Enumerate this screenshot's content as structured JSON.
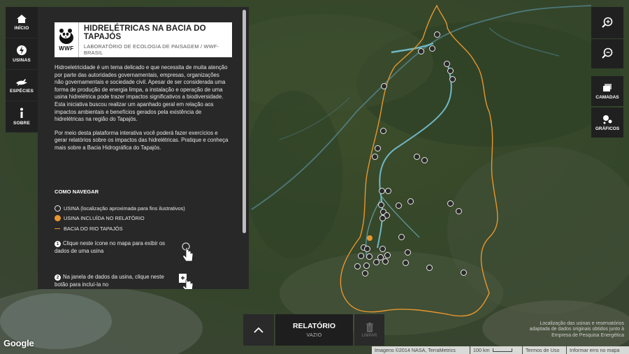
{
  "nav": {
    "items": [
      {
        "label": "INÍCIO",
        "icon": "home-icon"
      },
      {
        "label": "USINAS",
        "icon": "lightning-icon"
      },
      {
        "label": "ESPÉCIES",
        "icon": "bird-icon"
      },
      {
        "label": "SOBRE",
        "icon": "info-icon"
      }
    ]
  },
  "panel": {
    "logo_wwf": "WWF",
    "title": "HIDRELÉTRICAS NA BACIA DO TAPAJÓS",
    "subtitle": "LABORATÓRIO DE ECOLOGIA DE PAISAGEM / WWF-BRASIL",
    "intro_p1": "Hidroeletricidade é um tema delicado e que necessita de muita atenção por parte das autoridades governamentais, empresas, organizações não governamentais e sociedade civil. Apesar de ser considerada uma forma de produção de energia limpa, a instalação e operação de uma usina hidrelétrica pode trazer impactos significativos a biodiversidade. Esta iniciativa buscou realizar um apanhado geral em relação aos impactos ambientais e benefícios gerados pela existência de hidrelétricas na região do Tapajós.",
    "intro_p2": "Por meio desta plataforma interativa você poderá fazer exercícios e gerar relatórios sobre os impactos das hidrelétricas. Pratique e conheça mais sobre a Bacia Hidrográfica do Tapajós.",
    "how_title": "COMO NAVEGAR",
    "legend": {
      "usina": "USINA (localização aproximada para fins ilustrativos)",
      "included": "USINA INCLUÍDA NO RELATÓRIO",
      "basin": "BACIA DO RIO TAPAJÓS"
    },
    "step1_num": "1",
    "step1": "Clique neste ícone no mapa para exibir os dados de uma usina",
    "step2_num": "2",
    "step2": "Na janela de dados da usina, clique neste botão para incluí-la no"
  },
  "controls": {
    "zoom_in_icon": "zoom-in-icon",
    "zoom_out_icon": "zoom-out-icon",
    "layers": "CAMADAS",
    "charts": "GRÁFICOS"
  },
  "report": {
    "title": "RELATÓRIO",
    "status": "VAZIO",
    "clear": "LIMPAR"
  },
  "attribution": {
    "source_line1": "Localização das usinas e reservatórios",
    "source_line2": "adaptada de dados originais obtidos junto à",
    "source_line3": "Empresa de Pesquisa Energética",
    "imagery": "Imagens ©2014 NASA, TerraMetrics",
    "scale": "100 km",
    "terms": "Termos de Uso",
    "report_error": "Informar erro no mapa",
    "google": "Google"
  },
  "colors": {
    "panel_bg": "#282828",
    "accent_orange": "#e8962e",
    "river": "#6fb8c8"
  }
}
